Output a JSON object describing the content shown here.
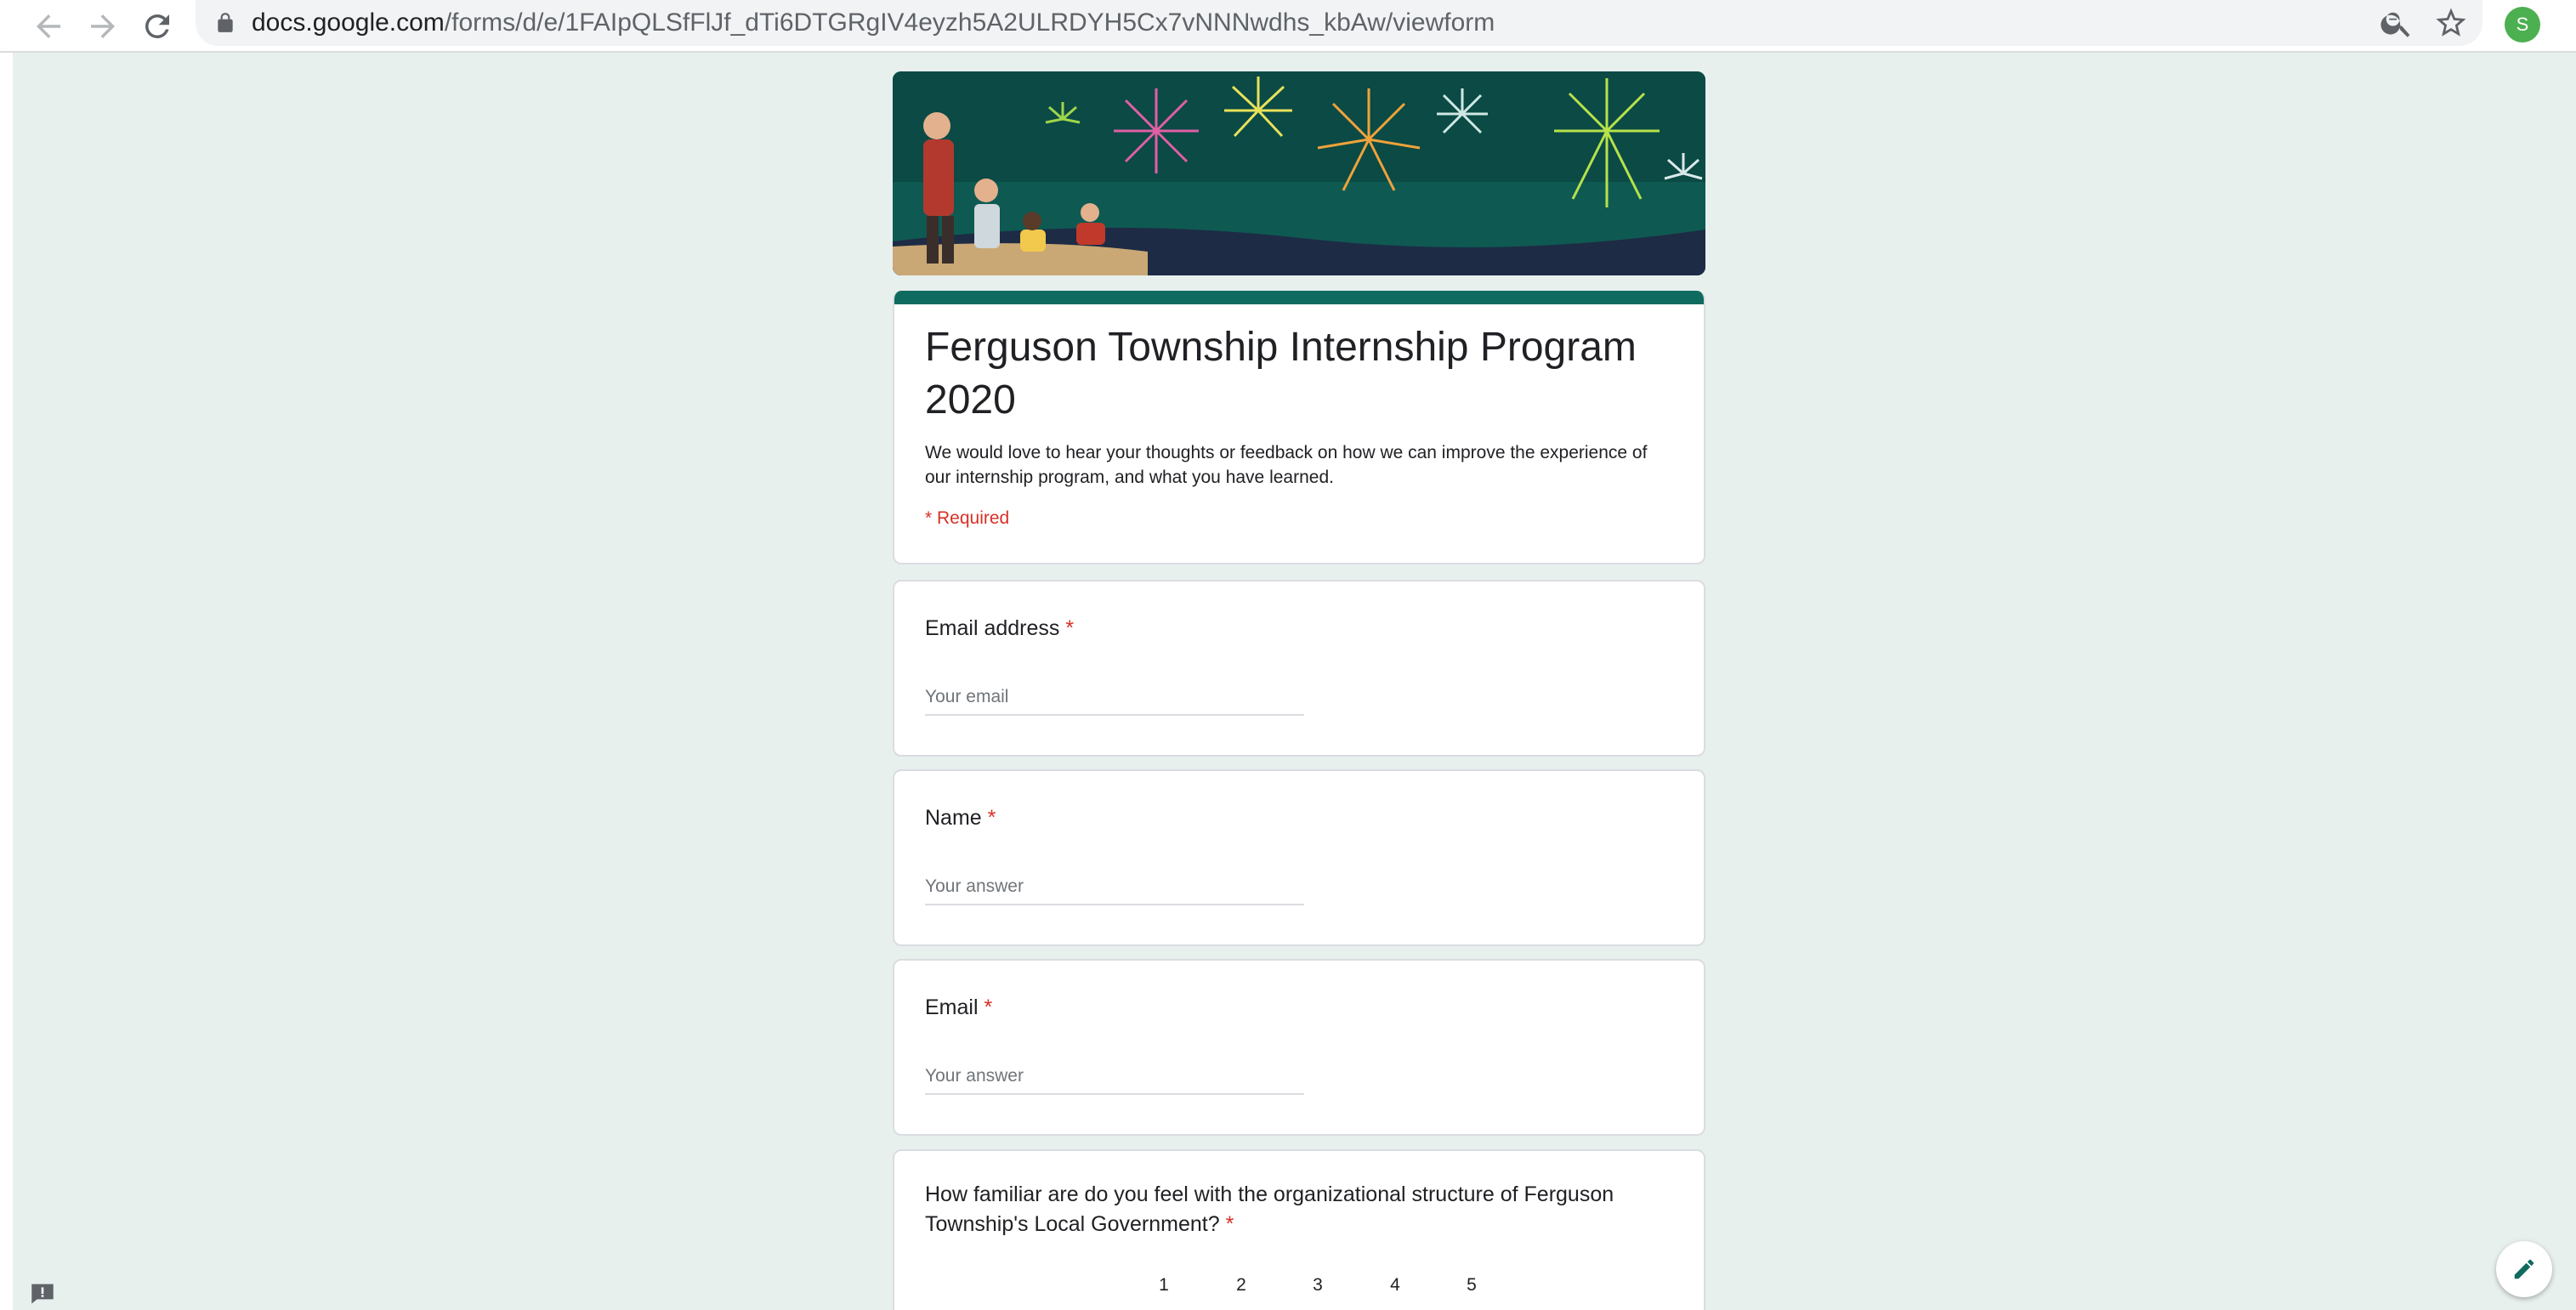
{
  "browser": {
    "url_host": "docs.google.com",
    "url_path": "/forms/d/e/1FAIpQLSfFlJf_dTi6DTGRgIV4eyzh5A2ULRDYH5Cx7vNNNwdhs_kbAw/viewform",
    "profile_initial": "S",
    "icons": [
      "back-arrow-icon",
      "forward-arrow-icon",
      "reload-icon",
      "lock-icon",
      "zoom-out-icon",
      "star-bookmark-icon"
    ]
  },
  "form": {
    "title": "Ferguson Township Internship Program 2020",
    "description": "We would love to hear your thoughts or feedback on how we can improve the experience of our internship program, and what you have learned.",
    "required_note": "* Required",
    "accent_color": "#0f6b5f",
    "questions": [
      {
        "label": "Email address",
        "required_mark": "*",
        "placeholder": "Your email"
      },
      {
        "label": "Name",
        "required_mark": "*",
        "placeholder": "Your answer"
      },
      {
        "label": "Email",
        "required_mark": "*",
        "placeholder": "Your answer"
      }
    ],
    "scale_question": {
      "label": "How familiar are do you feel with the organizational structure of Ferguson Township's Local Government?",
      "required_mark": "*",
      "scale": [
        "1",
        "2",
        "3",
        "4",
        "5"
      ]
    }
  },
  "colors": {
    "page_background": "#e8f0ee",
    "required_red": "#d93025",
    "avatar_green": "#4caf50"
  }
}
